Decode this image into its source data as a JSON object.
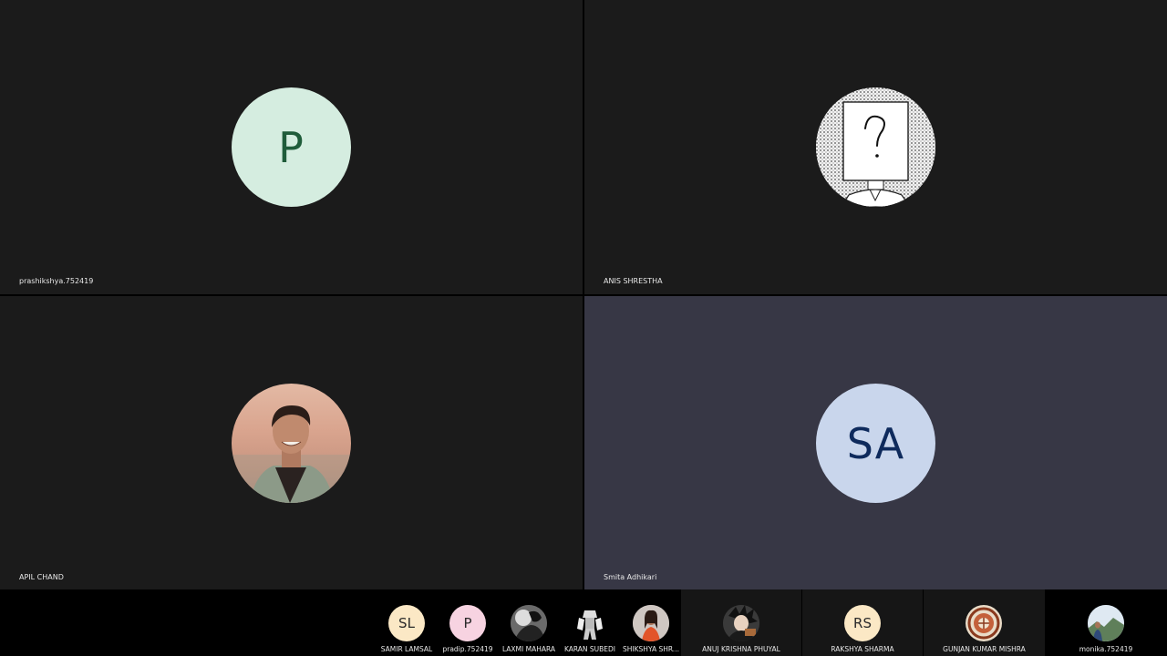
{
  "tiles": [
    {
      "name": "prashikshya.752419",
      "initials": "P",
      "avatar_bg": "#d5ede0",
      "initials_color": "#1f5c3a"
    },
    {
      "name": "ANIS SHRESTHA",
      "avatar_icon": "question-mark-portrait-icon"
    },
    {
      "name": "APIL CHAND",
      "avatar_icon": "profile-photo"
    },
    {
      "name": "Smita Adhikari",
      "initials": "SA",
      "avatar_bg": "#c9d6ec",
      "initials_color": "#0e2a5c",
      "speaking": true
    }
  ],
  "participants": [
    {
      "name": "SAMIR LAMSAL",
      "initials": "SL",
      "avatar_bg": "#fbe8c5"
    },
    {
      "name": "pradip.752419",
      "initials": "P",
      "avatar_bg": "#f7d3e1"
    },
    {
      "name": "LAXMI MAHARA",
      "avatar_icon": "bw-photo"
    },
    {
      "name": "KARAN SUBEDI",
      "avatar_icon": "robot-photo"
    },
    {
      "name": "SHIKSHYA SHR...",
      "avatar_icon": "profile-photo"
    },
    {
      "name": "ANUJ KRISHNA PHUYAL",
      "avatar_icon": "anime-photo"
    },
    {
      "name": "RAKSHYA SHARMA",
      "initials": "RS",
      "avatar_bg": "#fbe8c5"
    },
    {
      "name": "GUNJAN KUMAR MISHRA",
      "avatar_icon": "seal-logo"
    },
    {
      "name": "monika.752419",
      "avatar_icon": "landscape-photo"
    }
  ]
}
